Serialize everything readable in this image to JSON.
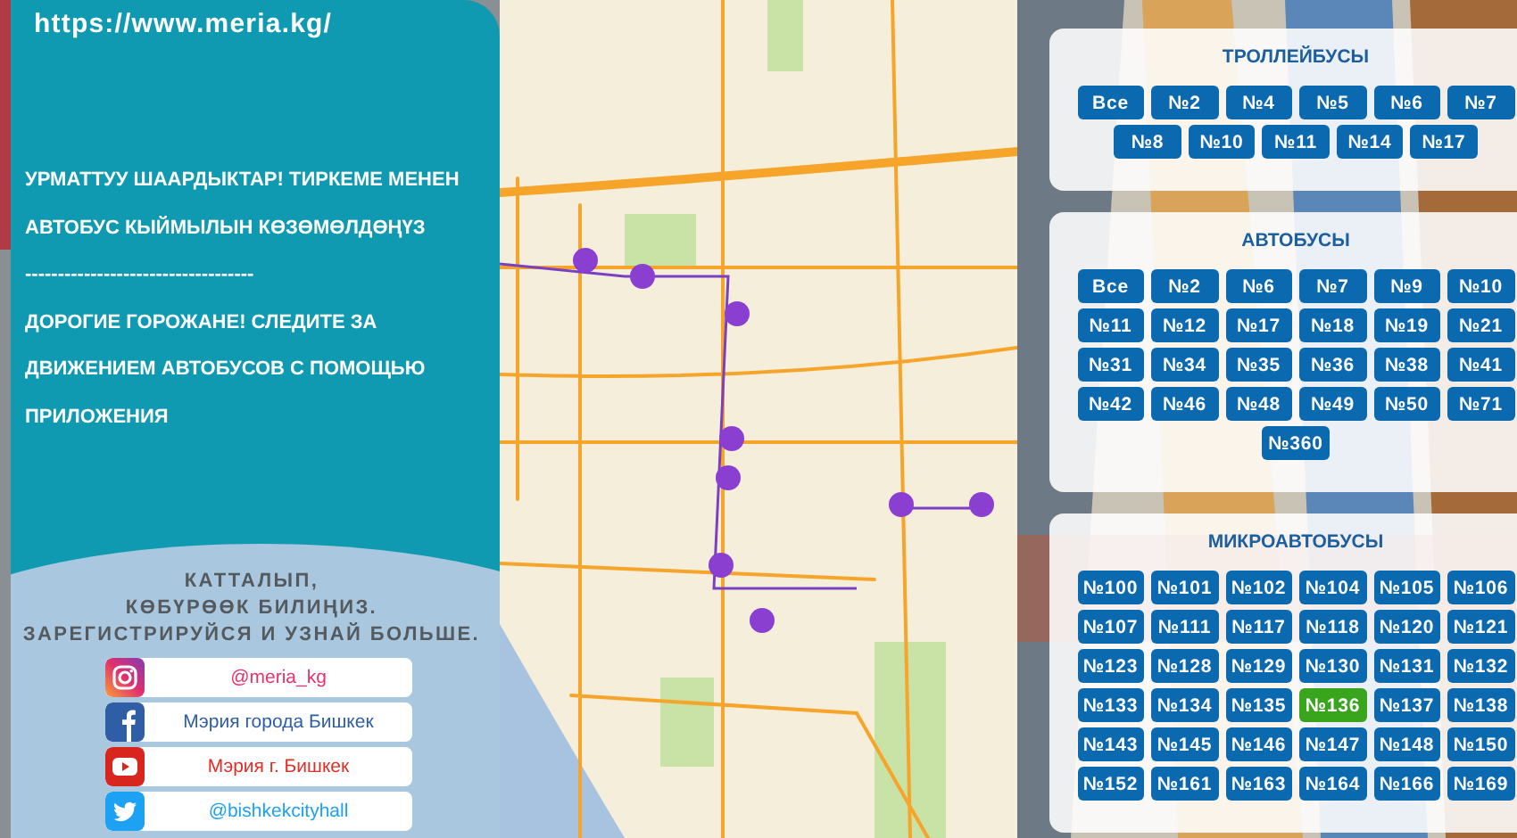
{
  "site_url": "https://www.meria.kg/",
  "message": [
    "УРМАТТУУ ШААРДЫКТАР! ТИРКЕМЕ МЕНЕН АВТОБУС КЫЙМЫЛЫН КӨЗӨМӨЛДӨҢҮЗ",
    "-----------------------------------",
    "ДОРОГИЕ ГОРОЖАНЕ! СЛЕДИТЕ ЗА ДВИЖЕНИЕМ АВТОБУСОВ С ПОМОЩЬЮ ПРИЛОЖЕНИЯ"
  ],
  "social": {
    "heading": [
      "КАТТАЛЫП,",
      "КӨБҮРӨӨК БИЛИҢИЗ.",
      "ЗАРЕГИСТРИРУЙСЯ И УЗНАЙ БОЛЬШЕ."
    ],
    "links": [
      {
        "kind": "instagram",
        "text": "@meria_kg",
        "color": "#e8336a"
      },
      {
        "kind": "facebook",
        "text": "Мэрия города Бишкек",
        "color": "#2f5ea6"
      },
      {
        "kind": "youtube",
        "text": "Мэрия г. Бишкек",
        "color": "#e52d27"
      },
      {
        "kind": "twitter",
        "text": "@bishkekcityhall",
        "color": "#1da1f2"
      }
    ]
  },
  "map": {
    "kind": "picture"
  },
  "route_groups": [
    {
      "title": "ТРОЛЛЕЙБУСЫ",
      "routes": [
        {
          "label": "Все",
          "selected": false
        },
        {
          "label": "№2",
          "selected": false
        },
        {
          "label": "№4",
          "selected": false
        },
        {
          "label": "№5",
          "selected": false
        },
        {
          "label": "№6",
          "selected": false
        },
        {
          "label": "№7",
          "selected": false
        },
        {
          "label": "№8",
          "selected": false
        },
        {
          "label": "№10",
          "selected": false
        },
        {
          "label": "№11",
          "selected": false
        },
        {
          "label": "№14",
          "selected": false
        },
        {
          "label": "№17",
          "selected": false
        }
      ]
    },
    {
      "title": "АВТОБУСЫ",
      "routes": [
        {
          "label": "Все",
          "selected": false
        },
        {
          "label": "№2",
          "selected": false
        },
        {
          "label": "№6",
          "selected": false
        },
        {
          "label": "№7",
          "selected": false
        },
        {
          "label": "№9",
          "selected": false
        },
        {
          "label": "№10",
          "selected": false
        },
        {
          "label": "№11",
          "selected": false
        },
        {
          "label": "№12",
          "selected": false
        },
        {
          "label": "№17",
          "selected": false
        },
        {
          "label": "№18",
          "selected": false
        },
        {
          "label": "№19",
          "selected": false
        },
        {
          "label": "№21",
          "selected": false
        },
        {
          "label": "№31",
          "selected": false
        },
        {
          "label": "№34",
          "selected": false
        },
        {
          "label": "№35",
          "selected": false
        },
        {
          "label": "№36",
          "selected": false
        },
        {
          "label": "№38",
          "selected": false
        },
        {
          "label": "№41",
          "selected": false
        },
        {
          "label": "№42",
          "selected": false
        },
        {
          "label": "№46",
          "selected": false
        },
        {
          "label": "№48",
          "selected": false
        },
        {
          "label": "№49",
          "selected": false
        },
        {
          "label": "№50",
          "selected": false
        },
        {
          "label": "№71",
          "selected": false
        },
        {
          "label": "№360",
          "selected": false
        }
      ]
    },
    {
      "title": "МИКРОАВТОБУСЫ",
      "routes": [
        {
          "label": "№100",
          "selected": false
        },
        {
          "label": "№101",
          "selected": false
        },
        {
          "label": "№102",
          "selected": false
        },
        {
          "label": "№104",
          "selected": false
        },
        {
          "label": "№105",
          "selected": false
        },
        {
          "label": "№106",
          "selected": false
        },
        {
          "label": "№107",
          "selected": false
        },
        {
          "label": "№111",
          "selected": false
        },
        {
          "label": "№117",
          "selected": false
        },
        {
          "label": "№118",
          "selected": false
        },
        {
          "label": "№120",
          "selected": false
        },
        {
          "label": "№121",
          "selected": false
        },
        {
          "label": "№123",
          "selected": false
        },
        {
          "label": "№128",
          "selected": false
        },
        {
          "label": "№129",
          "selected": false
        },
        {
          "label": "№130",
          "selected": false
        },
        {
          "label": "№131",
          "selected": false
        },
        {
          "label": "№132",
          "selected": false
        },
        {
          "label": "№133",
          "selected": false
        },
        {
          "label": "№134",
          "selected": false
        },
        {
          "label": "№135",
          "selected": false
        },
        {
          "label": "№136",
          "selected": true
        },
        {
          "label": "№137",
          "selected": false
        },
        {
          "label": "№138",
          "selected": false
        },
        {
          "label": "№143",
          "selected": false
        },
        {
          "label": "№145",
          "selected": false
        },
        {
          "label": "№146",
          "selected": false
        },
        {
          "label": "№147",
          "selected": false
        },
        {
          "label": "№148",
          "selected": false
        },
        {
          "label": "№150",
          "selected": false
        },
        {
          "label": "№152",
          "selected": false
        },
        {
          "label": "№161",
          "selected": false
        },
        {
          "label": "№163",
          "selected": false
        },
        {
          "label": "№164",
          "selected": false
        },
        {
          "label": "№166",
          "selected": false
        },
        {
          "label": "№169",
          "selected": false
        }
      ]
    }
  ]
}
